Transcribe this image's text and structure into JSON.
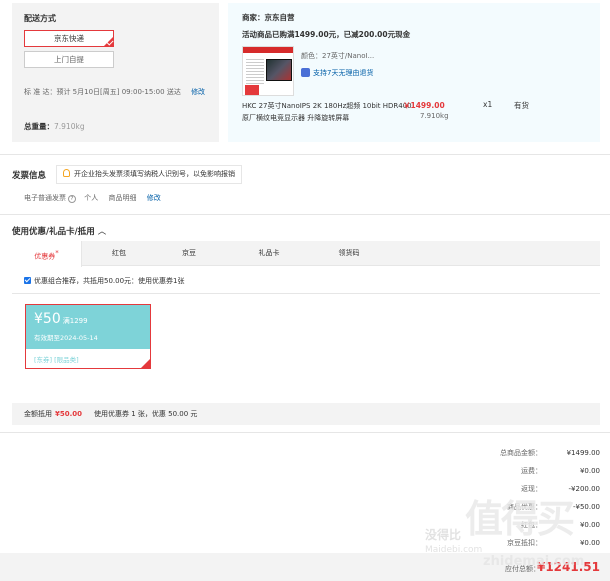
{
  "shipping": {
    "title": "配送方式",
    "options": [
      "京东快递",
      "上门自提"
    ],
    "selected": "京东快递",
    "date_label": "标 准 达：预计 5月10日[周五] 09:00-15:00 送达",
    "date_modify": "修改",
    "weight_label": "总重量：",
    "weight_value": "7.910kg"
  },
  "merchant": {
    "label": "商家：京东自营",
    "promo": "活动商品已购满1499.00元，已减200.00元现金",
    "product": {
      "color": "颜色：27英寸/NanoI...",
      "return_policy": "支持7天无理由退货",
      "name": "HKC 27英寸NanoIPS 2K 180Hz超频 10bit HDR400 原厂横纹电竞显示器 升降旋转屏幕",
      "price": "￥1499.00",
      "weight": "7.910kg",
      "qty": "x1",
      "stock": "有货"
    }
  },
  "invoice": {
    "title": "发票信息",
    "tip": "开企业抬头发票须填写纳税人识别号，以免影响报销",
    "type": "电子普通发票",
    "subject": "个人",
    "content": "商品明细",
    "modify": "修改"
  },
  "coupons": {
    "title": "使用优惠/礼品卡/抵用",
    "tabs": [
      "优惠券",
      "红包",
      "京豆",
      "礼品卡",
      "领货码"
    ],
    "active_tab": "优惠券",
    "combo_text": "优惠组合推荐，共抵用50.00元：使用优惠券1张",
    "coupon": {
      "amount": "¥50",
      "condition": "满1299",
      "expiry": "有效期至2024-05-14",
      "tags": "[东券] [限品类]"
    },
    "summary_label": "金额抵用",
    "summary_amount": "¥50.00",
    "summary_text": "使用优惠券 1 张，优惠 50.00 元"
  },
  "totals": {
    "rows": [
      {
        "label": "总商品金额：",
        "value": "¥1499.00"
      },
      {
        "label": "运费：",
        "value": "¥0.00"
      },
      {
        "label": "返现：",
        "value": "-¥200.00"
      },
      {
        "label": "商品优惠：",
        "value": "-¥50.00"
      },
      {
        "label": "红包：",
        "value": "¥0.00"
      },
      {
        "label": "京豆抵扣：",
        "value": "¥0.00"
      }
    ],
    "grand_label": "应付总额：",
    "grand_value": "¥1241.51"
  },
  "watermark": {
    "big": "值得买",
    "small": "没得比",
    "url1": "Maidebi.com",
    "url2": "zhidemai.com"
  },
  "colors": {
    "accent": "#e4393c",
    "link": "#005ea7",
    "coupon": "#7ed3d8"
  }
}
